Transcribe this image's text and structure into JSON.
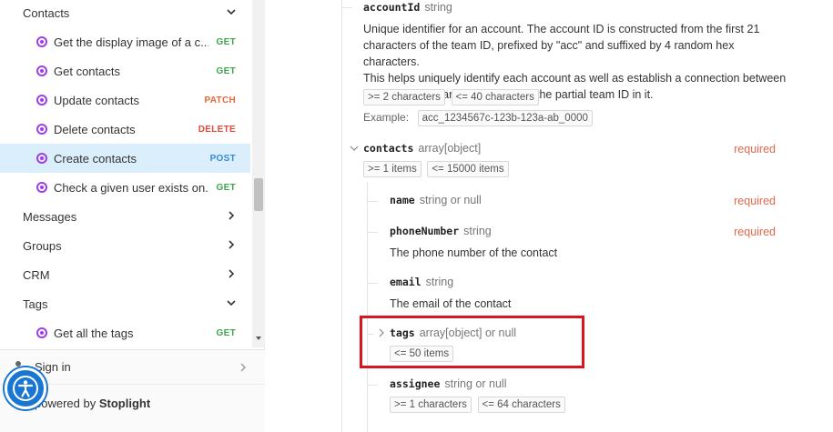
{
  "sidebar": {
    "groups": [
      {
        "label": "Contacts",
        "expanded": true
      },
      {
        "label": "Messages",
        "expanded": false
      },
      {
        "label": "Groups",
        "expanded": false
      },
      {
        "label": "CRM",
        "expanded": false
      },
      {
        "label": "Tags",
        "expanded": true
      }
    ],
    "contacts_items": [
      {
        "label": "Get the display image of a c...",
        "method": "GET"
      },
      {
        "label": "Get contacts",
        "method": "GET"
      },
      {
        "label": "Update contacts",
        "method": "PATCH"
      },
      {
        "label": "Delete contacts",
        "method": "DELETE"
      },
      {
        "label": "Create contacts",
        "method": "POST",
        "active": true
      },
      {
        "label": "Check a given user exists on...",
        "method": "GET"
      }
    ],
    "tags_items": [
      {
        "label": "Get all the tags",
        "method": "GET"
      }
    ],
    "footer": {
      "signin": "Sign in",
      "powered_prefix": "powered by",
      "powered_brand": "Stoplight"
    }
  },
  "main": {
    "accountId": {
      "name": "accountId",
      "type": "string",
      "description_lines": [
        "Unique identifier for an account. The account ID is constructed from the first 21",
        "characters of the team ID, prefixed by \"acc\" and suffixed by 4 random hex characters.",
        "This helps uniquely identify each account as well as establish a connection between",
        "the account's team by embedding the partial team ID in it."
      ],
      "chips": [
        ">= 2 characters",
        "<= 40 characters"
      ],
      "example_label": "Example:",
      "example_value": "acc_1234567c-123b-123a-ab_0000"
    },
    "contacts": {
      "name": "contacts",
      "type": "array[object]",
      "required": "required",
      "chips": [
        ">= 1 items",
        "<= 15000 items"
      ]
    },
    "name_prop": {
      "name": "name",
      "type": "string or null",
      "required": "required"
    },
    "phoneNumber": {
      "name": "phoneNumber",
      "type": "string",
      "required": "required",
      "description": "The phone number of the contact"
    },
    "email": {
      "name": "email",
      "type": "string",
      "description": "The email of the contact"
    },
    "tags": {
      "name": "tags",
      "type": "array[object] or null",
      "chips": [
        "<= 50 items"
      ]
    },
    "assignee": {
      "name": "assignee",
      "type": "string or null",
      "chips": [
        ">= 1 characters",
        "<= 64 characters"
      ]
    }
  },
  "colors": {
    "method_get": "#3fa34d",
    "method_patch": "#e06a3b",
    "method_delete": "#e0493b",
    "method_post": "#3a8ad6",
    "required": "#e0684b",
    "active_row": "#dbeefb",
    "highlight_box": "#d9161f",
    "a11y_button": "#1976d2"
  }
}
